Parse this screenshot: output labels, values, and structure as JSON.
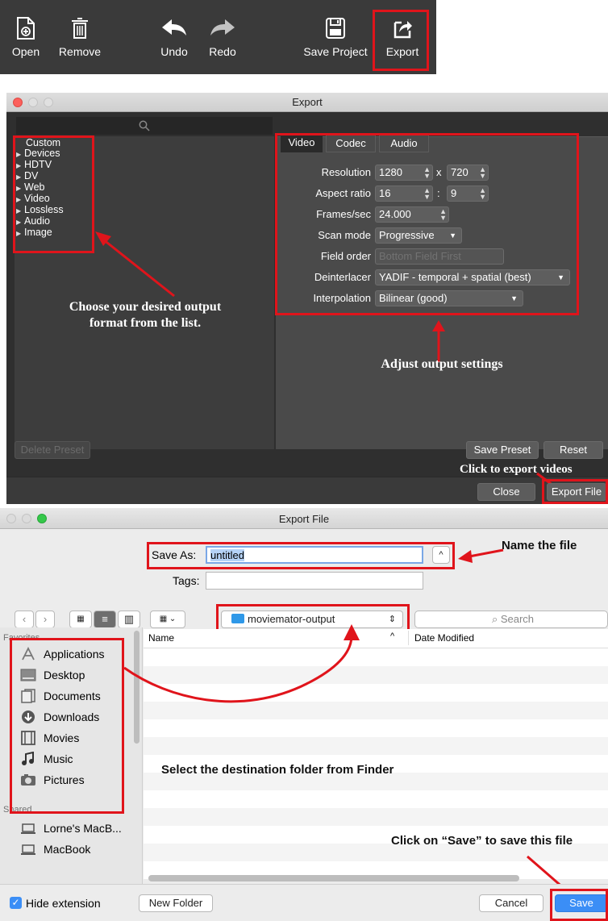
{
  "toolbar": {
    "items": [
      {
        "label": "Open"
      },
      {
        "label": "Remove"
      },
      {
        "label": "Undo"
      },
      {
        "label": "Redo"
      },
      {
        "label": "Save Project"
      },
      {
        "label": "Export"
      }
    ]
  },
  "export_window": {
    "title": "Export",
    "presets": [
      "Custom",
      "Devices",
      "HDTV",
      "DV",
      "Web",
      "Video",
      "Lossless",
      "Audio",
      "Image"
    ],
    "tabs": [
      "Video",
      "Codec",
      "Audio"
    ],
    "fields": {
      "resolution_label": "Resolution",
      "resolution_w": "1280",
      "resolution_x": "x",
      "resolution_h": "720",
      "aspect_label": "Aspect ratio",
      "aspect_w": "16",
      "aspect_colon": ":",
      "aspect_h": "9",
      "fps_label": "Frames/sec",
      "fps": "24.000",
      "scan_label": "Scan mode",
      "scan": "Progressive",
      "field_order_label": "Field order",
      "field_order": "Bottom Field First",
      "deinterlacer_label": "Deinterlacer",
      "deinterlacer": "YADIF - temporal + spatial (best)",
      "interpolation_label": "Interpolation",
      "interpolation": "Bilinear (good)"
    },
    "buttons": {
      "delete_preset": "Delete Preset",
      "save_preset": "Save Preset",
      "reset": "Reset",
      "close": "Close",
      "export_file": "Export File"
    },
    "annotations": {
      "choose_format": "Choose your desired output format from the list.",
      "adjust_settings": "Adjust output settings",
      "click_export": "Click to export videos"
    }
  },
  "finder_dialog": {
    "title": "Export File",
    "save_as_label": "Save As:",
    "save_as_value": "untitled",
    "tags_label": "Tags:",
    "folder": "moviemator-output",
    "search_placeholder": "Search",
    "columns": {
      "name": "Name",
      "date": "Date Modified"
    },
    "sidebar": {
      "favorites_heading": "Favorites",
      "favorites": [
        "Applications",
        "Desktop",
        "Documents",
        "Downloads",
        "Movies",
        "Music",
        "Pictures"
      ],
      "shared_heading": "Shared",
      "shared": [
        "Lorne's MacB...",
        "MacBook"
      ]
    },
    "hide_extension": "Hide extension",
    "new_folder": "New Folder",
    "cancel": "Cancel",
    "save": "Save",
    "annotations": {
      "name_file": "Name the file",
      "select_folder": "Select the destination folder from Finder",
      "click_save": "Click on “Save” to save this file"
    }
  },
  "colors": {
    "highlight": "#e0141b",
    "accent": "#1a84ff"
  }
}
